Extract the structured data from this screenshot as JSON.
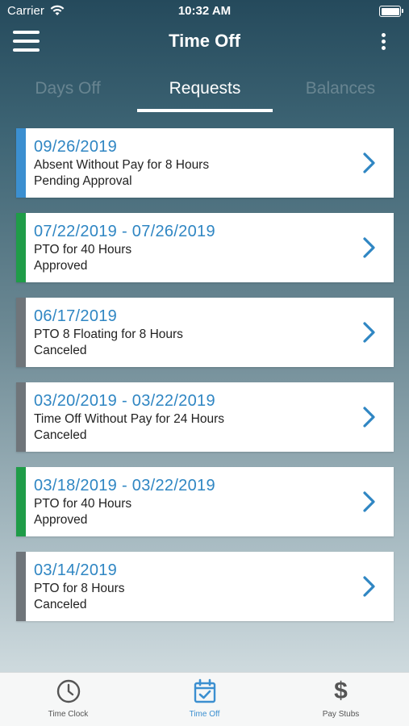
{
  "status_bar": {
    "carrier": "Carrier",
    "time": "10:32 AM"
  },
  "nav": {
    "title": "Time Off"
  },
  "tabs": [
    {
      "label": "Days Off",
      "active": false
    },
    {
      "label": "Requests",
      "active": true
    },
    {
      "label": "Balances",
      "active": false
    }
  ],
  "requests": [
    {
      "dates": "09/26/2019",
      "type": "Absent Without Pay for 8 Hours",
      "status": "Pending Approval",
      "status_color": "#3b8fd0"
    },
    {
      "dates": "07/22/2019 - 07/26/2019",
      "type": "PTO for 40 Hours",
      "status": "Approved",
      "status_color": "#1f9c48"
    },
    {
      "dates": "06/17/2019",
      "type": "PTO 8 Floating for 8 Hours",
      "status": "Canceled",
      "status_color": "#6f757a"
    },
    {
      "dates": "03/20/2019 - 03/22/2019",
      "type": "Time Off Without Pay for 24 Hours",
      "status": "Canceled",
      "status_color": "#6f757a"
    },
    {
      "dates": "03/18/2019 - 03/22/2019",
      "type": "PTO for 40 Hours",
      "status": "Approved",
      "status_color": "#1f9c48"
    },
    {
      "dates": "03/14/2019",
      "type": "PTO for 8 Hours",
      "status": "Canceled",
      "status_color": "#6f757a"
    }
  ],
  "tab_bar": {
    "items": [
      {
        "label": "Time Clock",
        "icon": "clock-icon",
        "active": false
      },
      {
        "label": "Time Off",
        "icon": "calendar-check-icon",
        "active": true
      },
      {
        "label": "Pay Stubs",
        "icon": "dollar-icon",
        "active": false,
        "glyph": "$"
      }
    ]
  },
  "colors": {
    "accent": "#3b8fd0",
    "approved": "#1f9c48",
    "canceled": "#6f757a"
  }
}
